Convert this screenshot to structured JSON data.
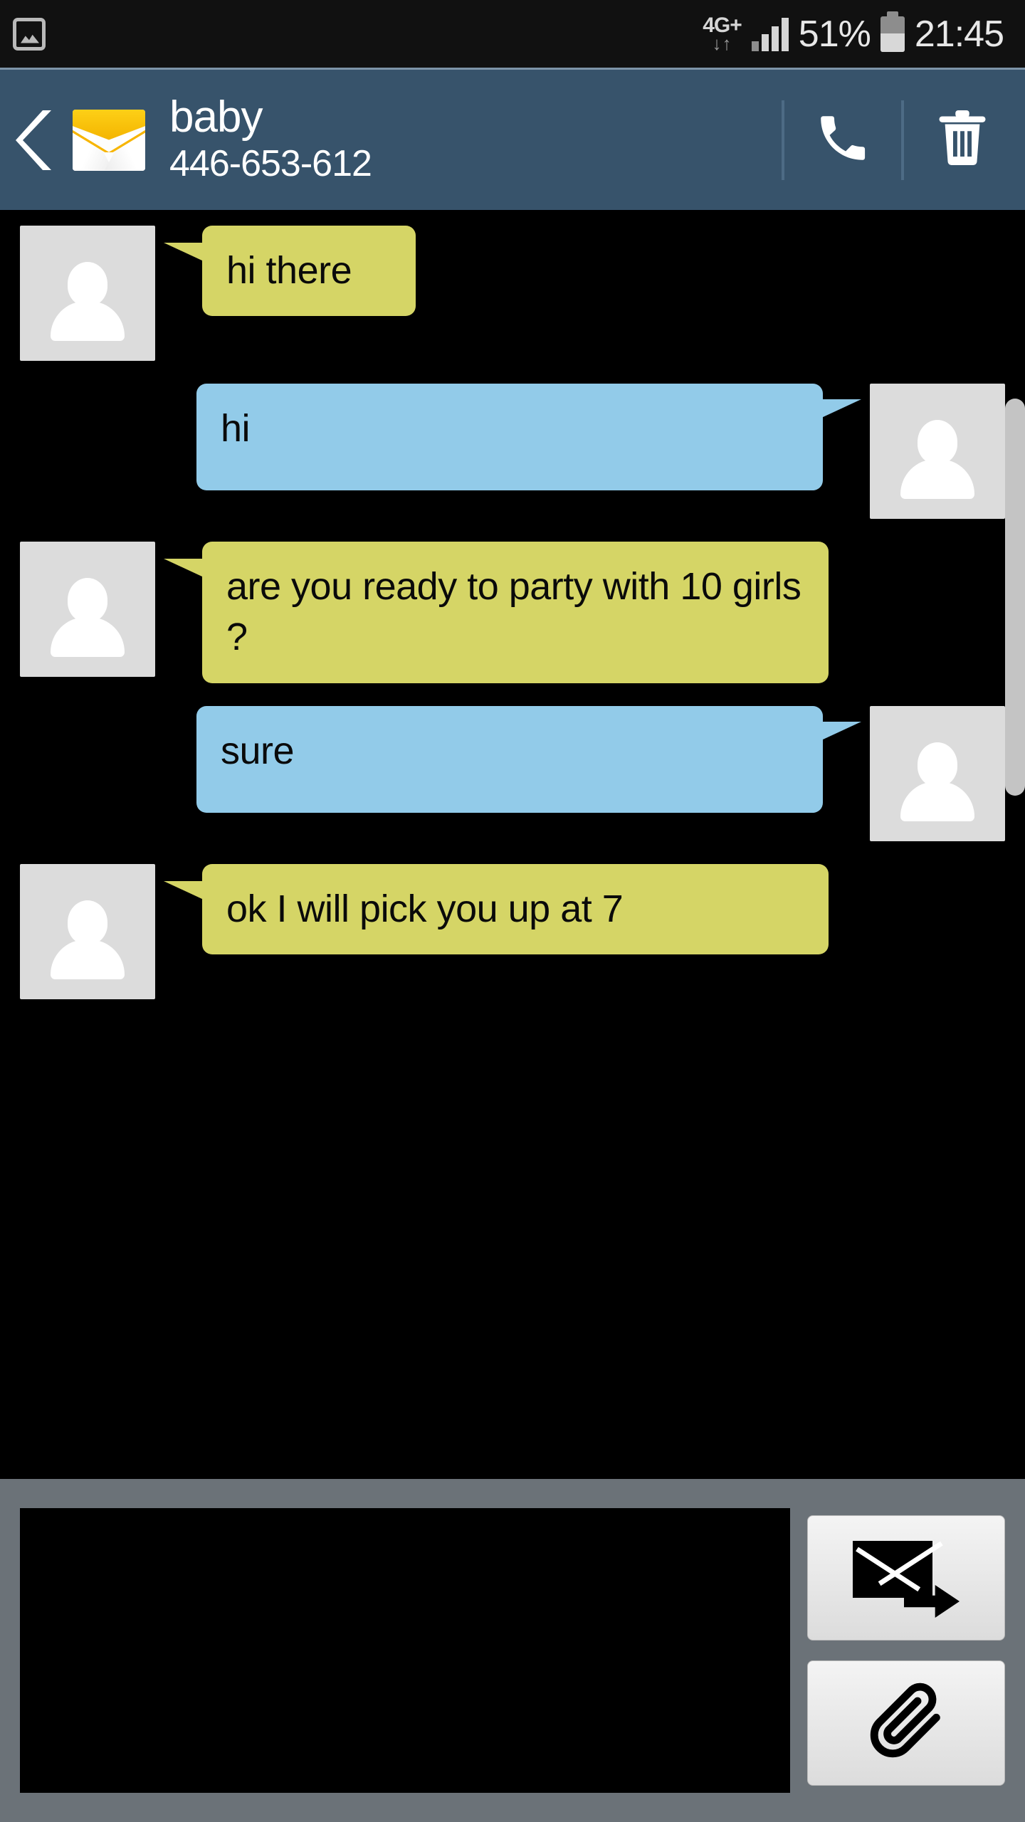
{
  "status_bar": {
    "notification_icon": "photo-icon",
    "network_type": "4G+",
    "data_arrows": "↓↑",
    "signal_icon": "signal-bars-icon",
    "battery_percent": "51%",
    "battery_icon": "battery-icon",
    "time": "21:45"
  },
  "header": {
    "back_icon": "back-chevron-icon",
    "app_icon": "envelope-icon",
    "contact_name": "baby",
    "contact_number": "446-653-612",
    "call_icon": "phone-icon",
    "delete_icon": "trash-icon"
  },
  "conversation": {
    "messages": [
      {
        "id": 1,
        "direction": "incoming",
        "text": "hi there",
        "avatar": "contact-avatar",
        "bubble_color": "#d5d566"
      },
      {
        "id": 2,
        "direction": "outgoing",
        "text": "hi",
        "avatar": "user-avatar",
        "bubble_color": "#92cbe9"
      },
      {
        "id": 3,
        "direction": "incoming",
        "text": "are you ready to party with 10 girls ?",
        "avatar": "contact-avatar",
        "bubble_color": "#d5d566"
      },
      {
        "id": 4,
        "direction": "outgoing",
        "text": "sure",
        "avatar": "user-avatar",
        "bubble_color": "#92cbe9"
      },
      {
        "id": 5,
        "direction": "incoming",
        "text": "ok I will pick you up at 7",
        "avatar": "contact-avatar",
        "bubble_color": "#d5d566"
      }
    ]
  },
  "composer": {
    "input_value": "",
    "input_placeholder": "",
    "send_icon": "send-message-icon",
    "attach_icon": "paperclip-icon"
  },
  "colors": {
    "status_bar_bg": "#111111",
    "header_bg": "#37536b",
    "header_top_border": "#7d94a8",
    "conversation_bg": "#000000",
    "incoming_bubble": "#d5d566",
    "outgoing_bubble": "#92cbe9",
    "avatar_bg": "#dcdcdc",
    "toolbar_bg": "#6b7278",
    "input_bg": "#000000",
    "button_bg": "#e9e9e9",
    "scrollbar_thumb": "#c4c4c4",
    "envelope_yellow": "#f4b400"
  }
}
